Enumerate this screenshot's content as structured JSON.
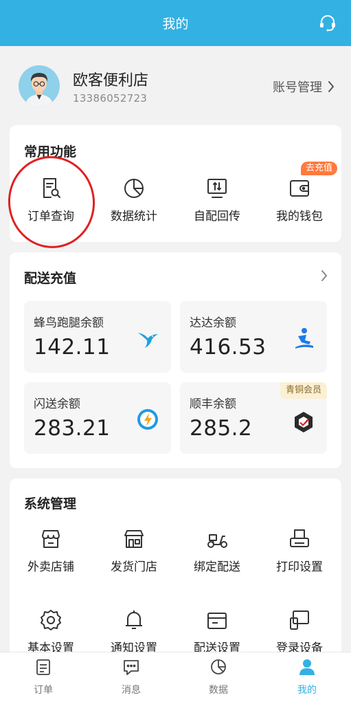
{
  "header": {
    "title": "我的",
    "support_icon": "headset-icon"
  },
  "profile": {
    "shop_name": "欧客便利店",
    "phone": "13386052723",
    "account_manage": "账号管理"
  },
  "common_functions": {
    "title": "常用功能",
    "recharge_badge": "去充值",
    "items": [
      {
        "label": "订单查询",
        "icon": "order-search-icon"
      },
      {
        "label": "数据统计",
        "icon": "pie-chart-icon"
      },
      {
        "label": "自配回传",
        "icon": "upload-monitor-icon"
      },
      {
        "label": "我的钱包",
        "icon": "wallet-icon"
      }
    ]
  },
  "delivery_recharge": {
    "title": "配送充值",
    "balances": [
      {
        "label": "蜂鸟跑腿余额",
        "value": "142.11",
        "icon": "hummingbird-icon"
      },
      {
        "label": "达达余额",
        "value": "416.53",
        "icon": "dada-runner-icon"
      },
      {
        "label": "闪送余额",
        "value": "283.21",
        "icon": "flash-icon"
      },
      {
        "label": "顺丰余额",
        "value": "285.2",
        "icon": "sf-express-icon",
        "badge": "青铜会员"
      }
    ]
  },
  "system_management": {
    "title": "系统管理",
    "items": [
      {
        "label": "外卖店铺",
        "icon": "store-icon"
      },
      {
        "label": "发货门店",
        "icon": "shop-front-icon"
      },
      {
        "label": "绑定配送",
        "icon": "scooter-icon"
      },
      {
        "label": "打印设置",
        "icon": "printer-icon"
      },
      {
        "label": "基本设置",
        "icon": "gear-icon"
      },
      {
        "label": "通知设置",
        "icon": "bell-icon"
      },
      {
        "label": "配送设置",
        "icon": "delivery-box-icon"
      },
      {
        "label": "登录设备",
        "icon": "devices-icon"
      }
    ]
  },
  "bottom_nav": {
    "active_index": 3,
    "items": [
      {
        "label": "订单",
        "icon": "order-list-icon"
      },
      {
        "label": "消息",
        "icon": "message-icon"
      },
      {
        "label": "数据",
        "icon": "pie-chart-icon"
      },
      {
        "label": "我的",
        "icon": "user-icon"
      }
    ]
  },
  "colors": {
    "primary": "#33b1e3",
    "badge_orange": "#ff7a3d",
    "annotation_red": "#e02020"
  }
}
